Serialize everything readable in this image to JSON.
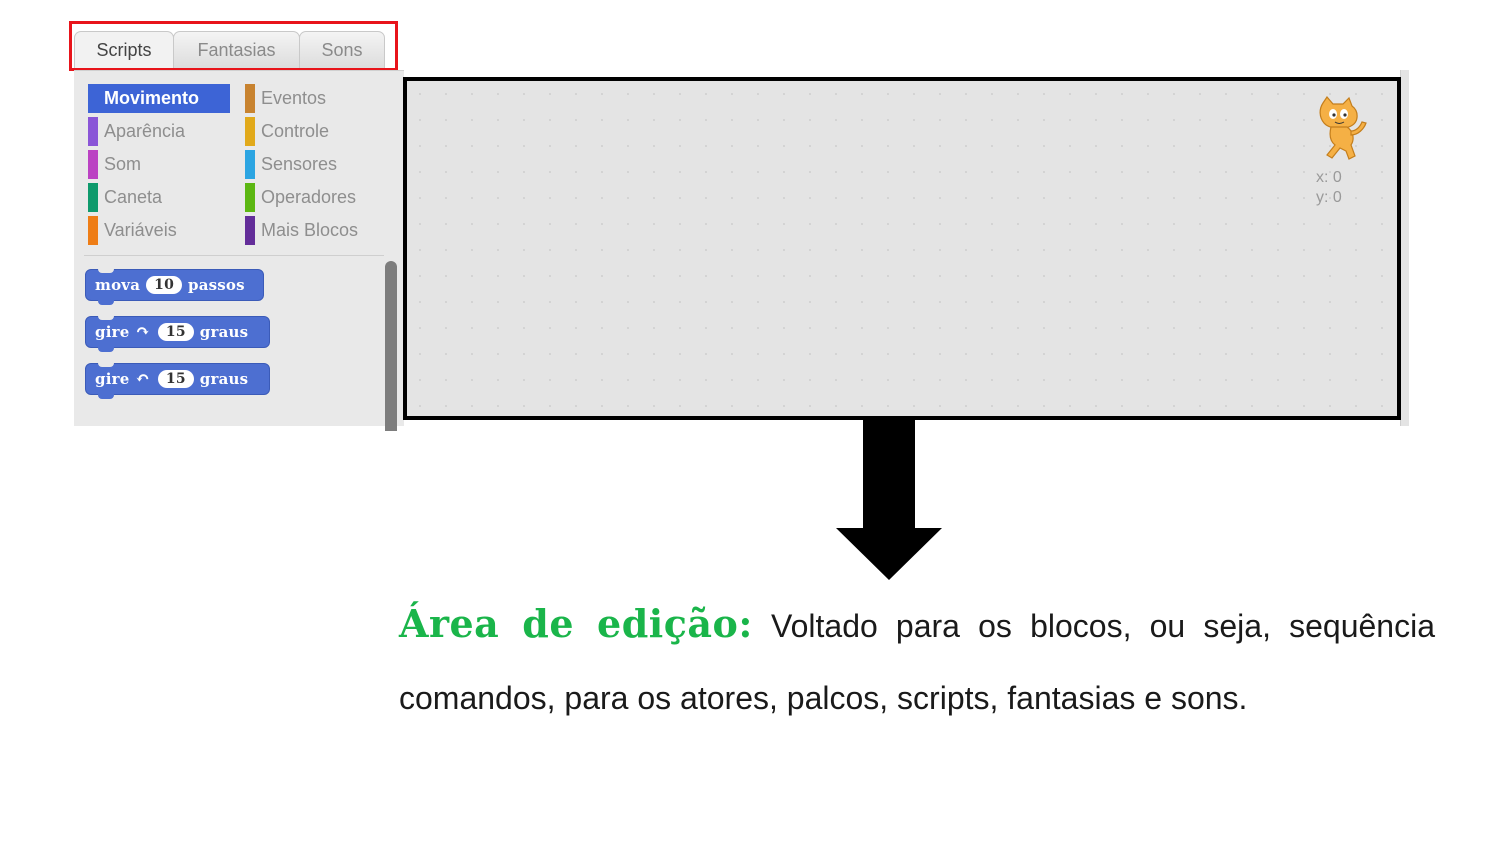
{
  "tabs": [
    {
      "label": "Scripts",
      "active": true
    },
    {
      "label": "Fantasias",
      "active": false
    },
    {
      "label": "Sons",
      "active": false
    }
  ],
  "highlight_color": "#e8141b",
  "categories": [
    {
      "label": "Movimento",
      "color": "#3d64d6",
      "active": true
    },
    {
      "label": "Eventos",
      "color": "#c88330"
    },
    {
      "label": "Aparência",
      "color": "#8a55d7"
    },
    {
      "label": "Controle",
      "color": "#e1a91a"
    },
    {
      "label": "Som",
      "color": "#bb42c3"
    },
    {
      "label": "Sensores",
      "color": "#2ca5e2"
    },
    {
      "label": "Caneta",
      "color": "#0e9a6c"
    },
    {
      "label": "Operadores",
      "color": "#5cb712"
    },
    {
      "label": "Variáveis",
      "color": "#ee7d16"
    },
    {
      "label": "Mais Blocos",
      "color": "#632d99"
    }
  ],
  "blocks": [
    {
      "pre": "mova",
      "num": "10",
      "post": "passos"
    },
    {
      "pre": "gire",
      "icon": "rotate-clockwise-icon",
      "glyph": "↷",
      "num": "15",
      "post": "graus"
    },
    {
      "pre": "gire",
      "icon": "rotate-counterclockwise-icon",
      "glyph": "↶",
      "num": "15",
      "post": "graus"
    }
  ],
  "sprite_info": {
    "x_label": "x: 0",
    "y_label": "y: 0"
  },
  "description": {
    "title": "Área de edição:",
    "text": "Voltado para os blocos, ou seja, sequência comandos, para os atores, palcos, scripts, fantasias e sons.",
    "title_color": "#1ab54a"
  }
}
